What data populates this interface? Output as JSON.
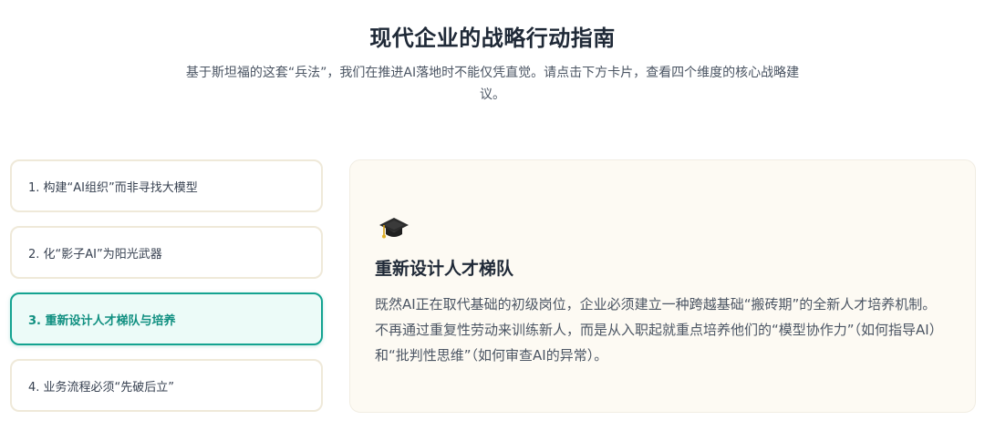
{
  "header": {
    "title": "现代企业的战略行动指南",
    "subtitle": "基于斯坦福的这套“兵法”，我们在推进AI落地时不能仅凭直觉。请点击下方卡片，查看四个维度的核心战略建议。"
  },
  "tabs": [
    {
      "label": "1. 构建“AI组织”而非寻找大模型",
      "active": false
    },
    {
      "label": "2. 化“影子AI”为阳光武器",
      "active": false
    },
    {
      "label": "3. 重新设计人才梯队与培养",
      "active": true
    },
    {
      "label": "4. 业务流程必须“先破后立”",
      "active": false
    }
  ],
  "panel": {
    "icon": "graduation-cap-icon",
    "title": "重新设计人才梯队",
    "body": "既然AI正在取代基础的初级岗位，企业必须建立一种跨越基础“搬砖期”的全新人才培养机制。不再通过重复性劳动来训练新人，而是从入职起就重点培养他们的“模型协作力”（如何指导AI）和“批判性思维”（如何审查AI的异常）。"
  },
  "colors": {
    "accent": "#14a391",
    "active_bg": "#ecfbf8",
    "card_border": "#efe9d9",
    "panel_bg": "#fdfaf3"
  }
}
